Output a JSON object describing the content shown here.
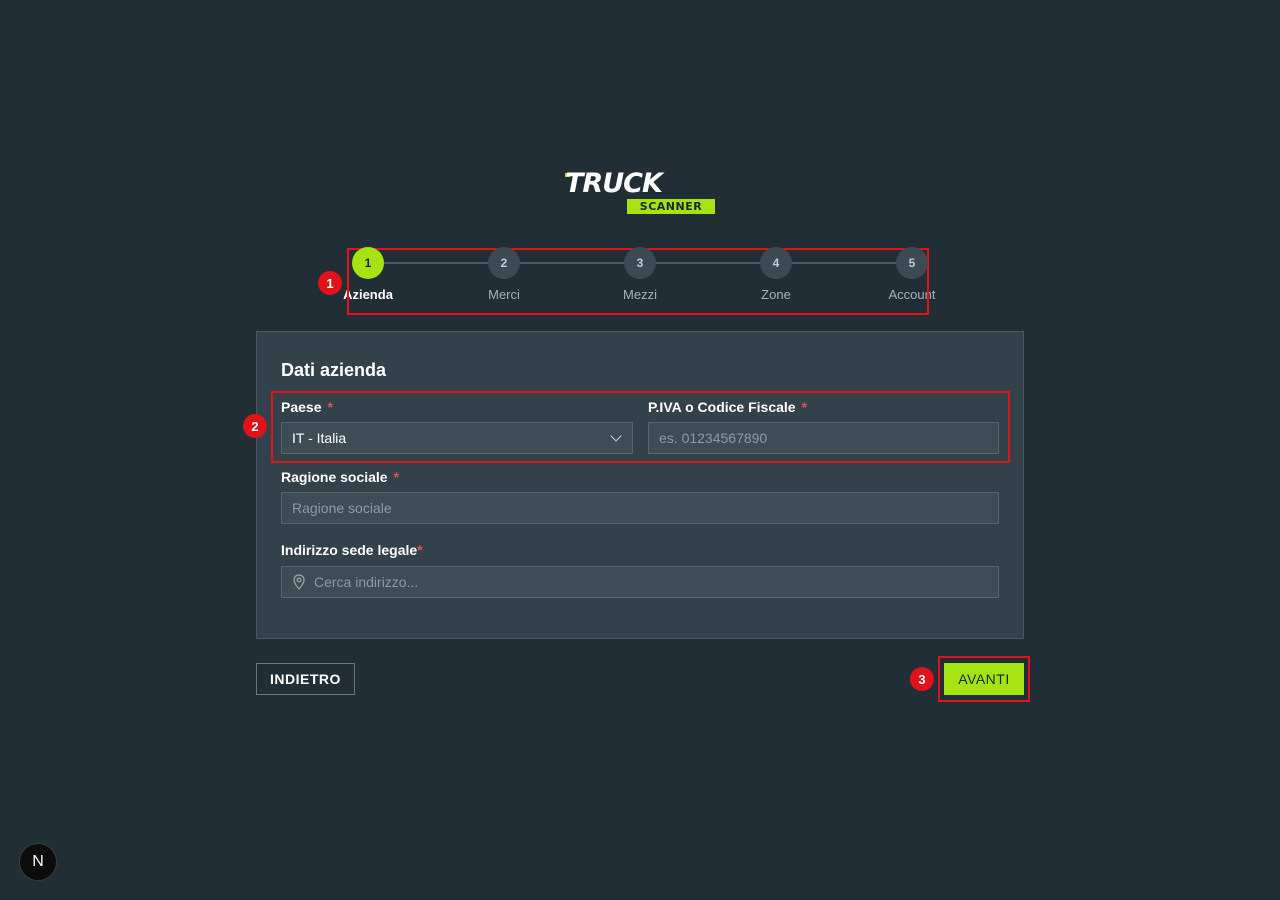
{
  "logo": {
    "word": "TRUCK",
    "sub": "SCANNER"
  },
  "stepper": {
    "steps": [
      {
        "number": "1",
        "label": "Azienda",
        "active": true
      },
      {
        "number": "2",
        "label": "Merci",
        "active": false
      },
      {
        "number": "3",
        "label": "Mezzi",
        "active": false
      },
      {
        "number": "4",
        "label": "Zone",
        "active": false
      },
      {
        "number": "5",
        "label": "Account",
        "active": false
      }
    ]
  },
  "form": {
    "title": "Dati azienda",
    "required_mark": "*",
    "country": {
      "label": "Paese",
      "value": "IT - Italia"
    },
    "vat": {
      "label": "P.IVA o Codice Fiscale",
      "placeholder": "es. 01234567890"
    },
    "company_name": {
      "label": "Ragione sociale",
      "placeholder": "Ragione sociale"
    },
    "address": {
      "label": "Indirizzo sede legale",
      "placeholder": "Cerca indirizzo..."
    }
  },
  "actions": {
    "back_label": "INDIETRO",
    "next_label": "AVANTI"
  },
  "annotations": [
    "1",
    "2",
    "3"
  ],
  "dev_indicator": "N",
  "colors": {
    "accent": "#a6e312",
    "background": "#222e36",
    "card": "#33414a",
    "required": "#e4534f",
    "annotation": "#e0121a"
  }
}
